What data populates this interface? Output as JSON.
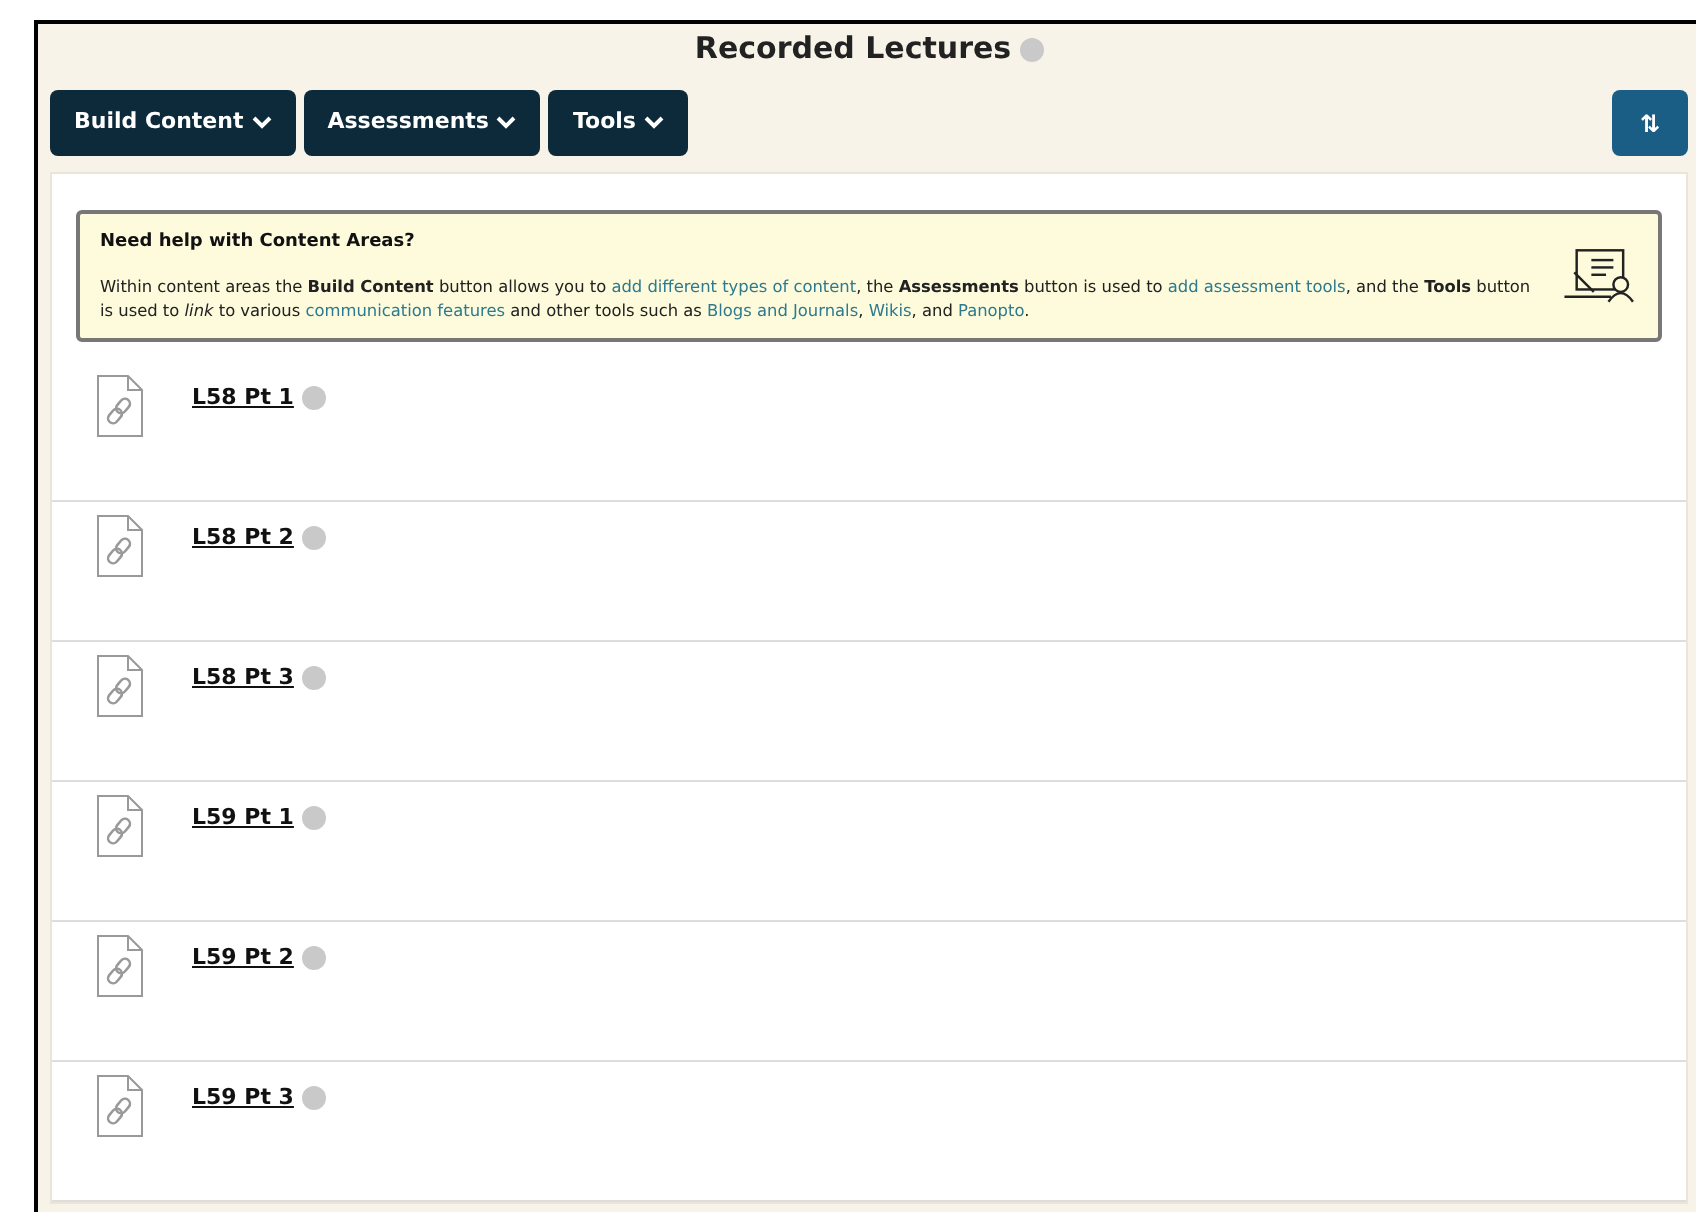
{
  "page": {
    "title": "Recorded Lectures"
  },
  "toolbar": {
    "buttons": [
      {
        "label": "Build Content"
      },
      {
        "label": "Assessments"
      },
      {
        "label": "Tools"
      }
    ],
    "sort_button": "⇅"
  },
  "help_box": {
    "heading": "Need help with Content Areas?",
    "segments": [
      {
        "kind": "plain",
        "text": "Within content areas the **Build Content** button allows you to "
      },
      {
        "kind": "link",
        "text": "add different types of content"
      },
      {
        "kind": "plain",
        "text": ", the **Assessments** button is used to "
      },
      {
        "kind": "link",
        "text": "add assessment tools"
      },
      {
        "kind": "plain",
        "text": ", and the **Tools** button is used to *link* to various "
      },
      {
        "kind": "link",
        "text": "communication features"
      },
      {
        "kind": "plain",
        "text": " and other tools such as "
      },
      {
        "kind": "link",
        "text": "Blogs and Journals"
      },
      {
        "kind": "plain",
        "text": ", "
      },
      {
        "kind": "link",
        "text": "Wikis"
      },
      {
        "kind": "plain",
        "text": ", and "
      },
      {
        "kind": "link",
        "text": "Panopto"
      },
      {
        "kind": "plain",
        "text": "."
      }
    ]
  },
  "items": [
    {
      "title": "L58 Pt 1"
    },
    {
      "title": "L58 Pt 2"
    },
    {
      "title": "L58 Pt 3"
    },
    {
      "title": "L59 Pt 1"
    },
    {
      "title": "L59 Pt 2"
    },
    {
      "title": "L59 Pt 3"
    }
  ]
}
